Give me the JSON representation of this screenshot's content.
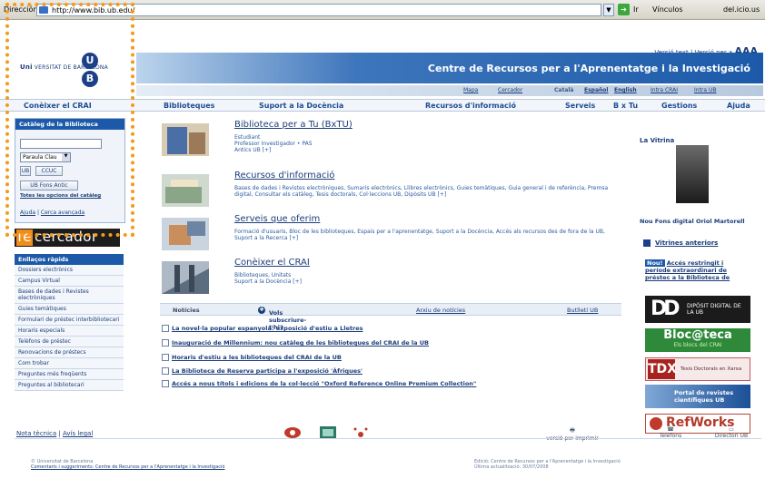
{
  "browser": {
    "address_label": "Dirección",
    "url": "http://www.bib.ub.edu/",
    "go_label": "Ir",
    "links_label": "Vínculos",
    "extension_label": "del.icio.us"
  },
  "top_tools": {
    "links": "Versió text | Versió per a",
    "font_sizes": "AAA"
  },
  "logo": {
    "name_prefix": "Uni",
    "name_rest": "VERSITAT DE BARCELONA",
    "crest_top": "U",
    "crest_bottom": "B"
  },
  "header": {
    "title": "Centre de Recursos per a l'Aprenentatge i la Investigació",
    "sub_links": [
      "Mapa",
      "Cercador",
      "Català",
      "Español",
      "English",
      "Intra CRAI",
      "Intra UB"
    ]
  },
  "nav": [
    "Conèixer el CRAI",
    "Biblioteques",
    "Suport a la Docència",
    "Recursos d'informació",
    "Serveis",
    "B x Tu",
    "Gestions",
    "Ajuda"
  ],
  "catalog": {
    "title": "Catàleg de la Biblioteca",
    "search_value": "",
    "select_value": "Paraula Clau",
    "buttons": [
      "UB",
      "CCUC",
      "UB Fons Antic"
    ],
    "all_link": "Totes les opcions del catàleg",
    "help_links": [
      "Ajuda",
      "Cerca avançada"
    ]
  },
  "recercador": {
    "prefix": "re",
    "rest": "cercador"
  },
  "quick_links": {
    "title": "Enllaços ràpids",
    "items": [
      "Dossiers electrònics",
      "Campus Virtual",
      "Bases de dades i Revistes electròniques",
      "Guies temàtiques",
      "Formulari de préstec interbibliotecari",
      "Horaris especials",
      "Telèfons de préstec",
      "Renovacions de préstecs",
      "Com trobar",
      "Preguntes més freqüents",
      "Preguntes al bibliotecari"
    ]
  },
  "sections": [
    {
      "title": "Biblioteca per a Tu (BxTU)",
      "text": "Estudiant\nProfessor Investigador • PAS\nAntics UB [+]"
    },
    {
      "title": "Recursos d'informació",
      "text": "Bases de dades i Revistes electròniques, Sumaris electrònics, Llibres electrònics, Guies temàtiques, Guia general i de referència, Premsa digital, Consultar els catàleg, Tesis doctorals, Col·leccions UB, Dipòsits UB [+]"
    },
    {
      "title": "Serveis que oferim",
      "text": "Formació d'usuaris, Bloc de les biblioteques, Espais per a l'aprenentatge, Suport a la Docència, Accés als recursos des de fora de la UB, Suport a la Recerca [+]"
    },
    {
      "title": "Conèixer el CRAI",
      "text": "Biblioteques, Unitats\nSuport a la Docència [+]"
    }
  ],
  "news": {
    "label": "Notícies",
    "subscribe": "Vols subscriure-t'hi?",
    "archive": "Arxiu de notícies",
    "bulletins": "Butlletí UB",
    "items": [
      "La novel·la popular espanyola: exposició d'estiu a Lletres",
      "Inauguració de Millennium: nou catàleg de les biblioteques del CRAI de la UB",
      "Horaris d'estiu a les biblioteques del CRAI de la UB",
      "La Biblioteca de Reserva participa a l'exposició 'Àfriques'",
      "Accés a nous títols i edicions de la col·lecció \"Oxford Reference Online Premium Collection\""
    ]
  },
  "vitrina": {
    "title": "La Vitrina",
    "caption": "Nou Fons digital Oriol Martorell",
    "previous": "Vitrines anteriors",
    "promo_badge": "Nou!",
    "promo_text": "Accés restringit i període extraordinari de préstec a la Biblioteca de",
    "dipositiu": "DIPÒSIT DIGITAL DE LA UB",
    "blocoteca_title": "Bloc@teca",
    "blocoteca_sub": "Els blocs del CRAI",
    "tdx_label": "TDX",
    "tdx_text": "Tesis Doctorals en Xarxa",
    "portal_text": "Portal de revistes científiques UB",
    "refworks": "RefWorks"
  },
  "footer": {
    "links": [
      "Nota tècnica",
      "Avís legal"
    ],
    "icons": [
      "versió per imprimir",
      "Telèfons",
      "Directori UB"
    ],
    "copyright": "© Universitat de Barcelona",
    "contact": "Comentaris i suggeriments: Centre de Recursos per a l'Aprenentatge i la Investigació",
    "edit": "Edició: Centre de Recursos per a l'Aprenentatge i la Investigació",
    "updated": "Última actualització: 30/07/2008"
  }
}
